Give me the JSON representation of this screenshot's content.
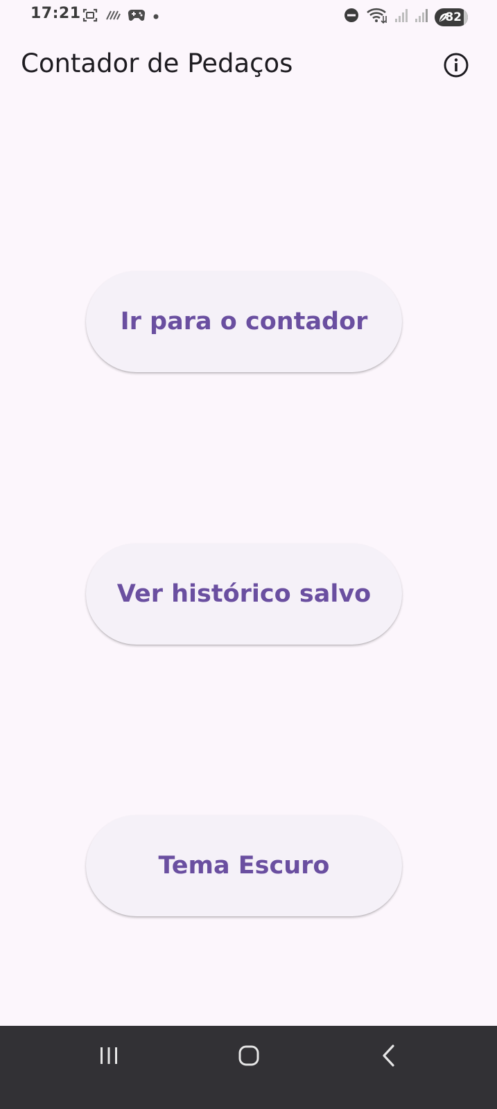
{
  "status_bar": {
    "time": "17:21",
    "battery_level": "82",
    "left_icons": [
      "screenshot-icon",
      "signal-hatch-icon",
      "game-controller-icon",
      "notification-dot-icon"
    ],
    "right_icons": [
      "do-not-disturb-icon",
      "wifi-icon",
      "signal-bars-icon",
      "signal-bars-icon",
      "battery-icon"
    ]
  },
  "app_bar": {
    "title": "Contador de Pedaços",
    "action_icon": "info-icon"
  },
  "main": {
    "buttons": [
      {
        "label": "Ir para o contador"
      },
      {
        "label": "Ver histórico salvo"
      },
      {
        "label": "Tema Escuro"
      }
    ]
  },
  "nav_bar": {
    "buttons": [
      "recents-icon",
      "home-icon",
      "back-icon"
    ]
  },
  "colors": {
    "background": "#fcf6fc",
    "button_surface": "#f5f1f8",
    "button_text": "#6a4fa0",
    "title_text": "#1d1b20",
    "nav_bar": "#323135"
  }
}
